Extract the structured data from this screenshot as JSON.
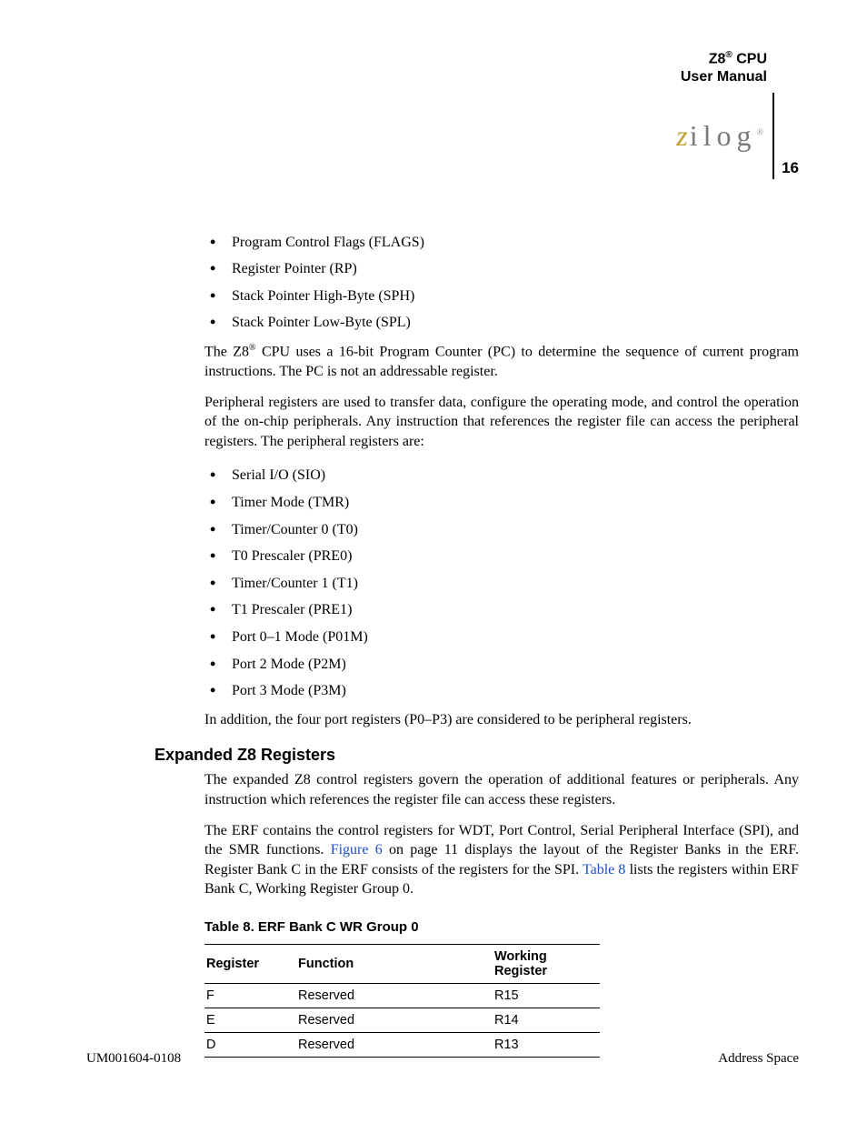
{
  "header": {
    "title_line1_pre": "Z8",
    "title_line1_sup": "®",
    "title_line1_post": " CPU",
    "title_line2": "User Manual",
    "logo_text": "ilog",
    "page_number": "16"
  },
  "list1": [
    "Program Control Flags (FLAGS)",
    "Register Pointer (RP)",
    "Stack Pointer High-Byte (SPH)",
    "Stack Pointer Low-Byte (SPL)"
  ],
  "para1_pre": "The Z8",
  "para1_sup": "®",
  "para1_post": " CPU uses a 16-bit Program Counter (PC) to determine the sequence of current program instructions. The PC is not an addressable register.",
  "para2": "Peripheral registers are used to transfer data, configure the operating mode, and control the operation of the on-chip peripherals. Any instruction that references the register file can access the peripheral registers. The peripheral registers are:",
  "list2": [
    "Serial I/O (SIO)",
    "Timer Mode (TMR)",
    "Timer/Counter 0 (T0)",
    "T0 Prescaler (PRE0)",
    "Timer/Counter 1 (T1)",
    "T1 Prescaler (PRE1)",
    "Port 0–1 Mode (P01M)",
    "Port 2 Mode (P2M)",
    "Port 3 Mode (P3M)"
  ],
  "para3": "In addition, the four port registers (P0–P3) are considered to be peripheral registers.",
  "section_heading": "Expanded Z8 Registers",
  "para4": "The expanded Z8 control registers govern the operation of additional features or peripherals. Any instruction which references the register file can access these registers.",
  "para5_1": "The ERF contains the control registers for WDT, Port Control, Serial Peripheral Interface (SPI), and the SMR functions. ",
  "para5_link1": "Figure 6",
  "para5_2": " on page 11 displays the layout of the Register Banks in the ERF. Register Bank C in the ERF consists of the registers for the SPI. ",
  "para5_link2": "Table 8",
  "para5_3": " lists the registers within ERF Bank C, Working Register Group 0.",
  "table": {
    "caption": "Table 8. ERF Bank C WR Group 0",
    "headers": [
      "Register",
      "Function",
      "Working Register"
    ],
    "rows": [
      [
        "F",
        "Reserved",
        "R15"
      ],
      [
        "E",
        "Reserved",
        "R14"
      ],
      [
        "D",
        "Reserved",
        "R13"
      ]
    ]
  },
  "footer": {
    "left": "UM001604-0108",
    "right": "Address Space"
  }
}
